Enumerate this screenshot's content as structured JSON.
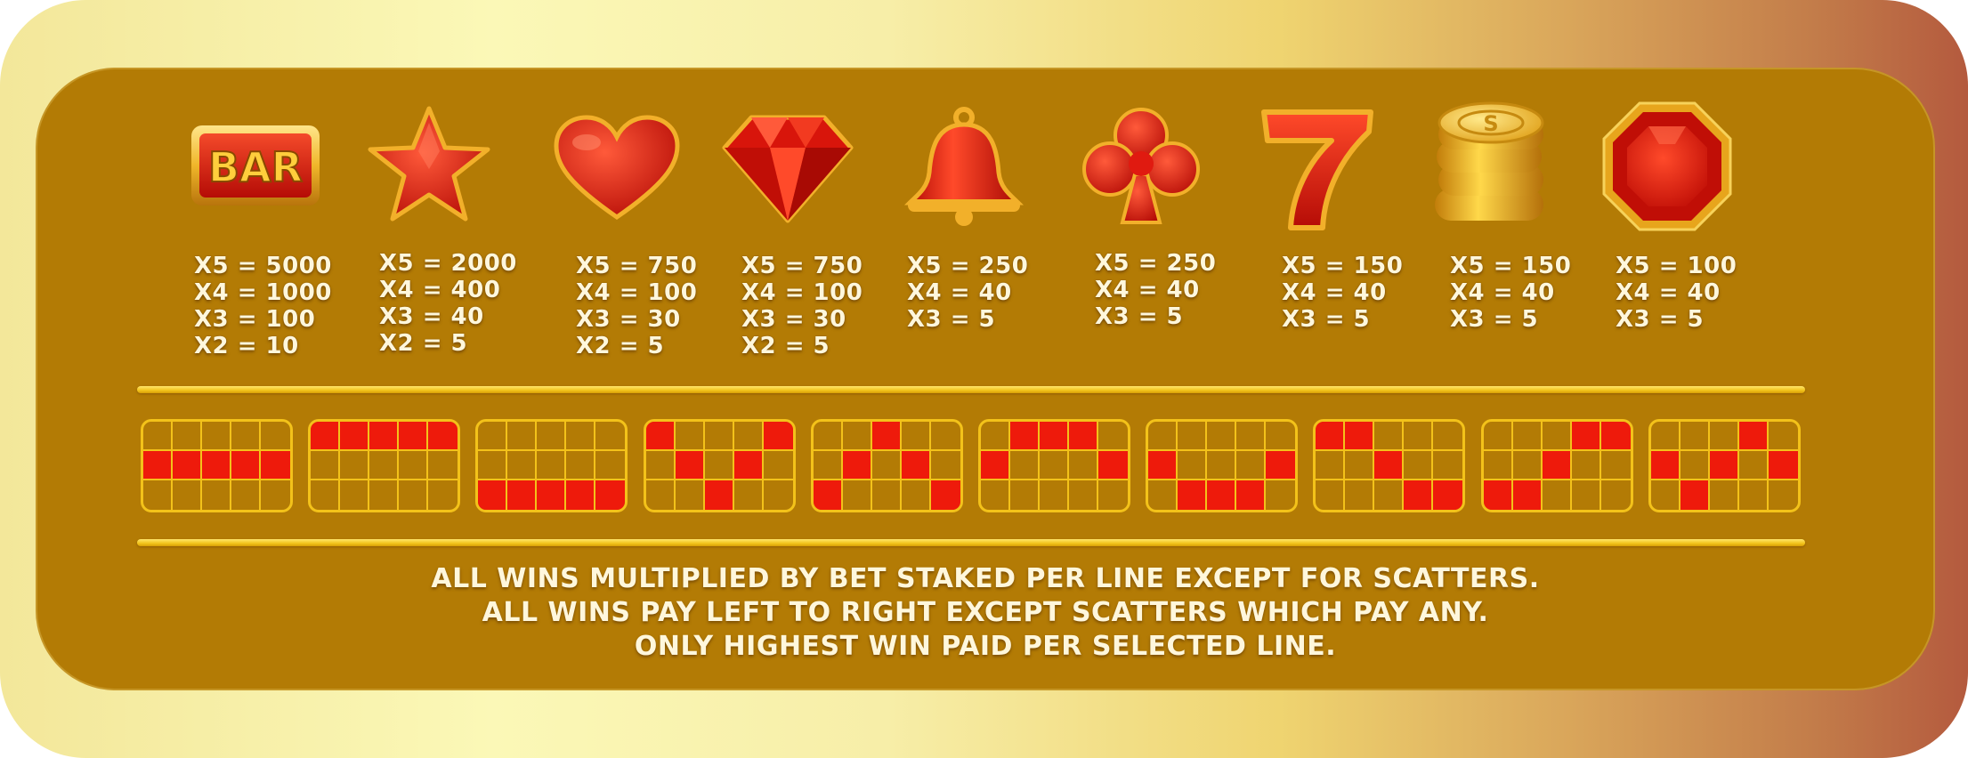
{
  "colors": {
    "panel": "#b37b05",
    "accent_gold": "#f3c21a",
    "symbol_red": "#e01a10",
    "text": "#fff7dc"
  },
  "symbols": [
    {
      "name": "bar",
      "icon": "bar-icon",
      "label": "BAR",
      "pays": [
        "X5 = 5000",
        "X4 = 1000",
        "X3 = 100",
        "X2 = 10"
      ]
    },
    {
      "name": "star",
      "icon": "star-icon",
      "pays": [
        "X5 = 2000",
        "X4 = 400",
        "X3 = 40",
        "X2 = 5"
      ]
    },
    {
      "name": "heart",
      "icon": "heart-icon",
      "pays": [
        "X5 = 750",
        "X4 = 100",
        "X3 = 30",
        "X2 = 5"
      ]
    },
    {
      "name": "diamond",
      "icon": "diamond-icon",
      "pays": [
        "X5 = 750",
        "X4 = 100",
        "X3 = 30",
        "X2 = 5"
      ]
    },
    {
      "name": "bell",
      "icon": "bell-icon",
      "pays": [
        "X5 = 250",
        "X4 = 40",
        "X3 = 5"
      ]
    },
    {
      "name": "clover",
      "icon": "clover-icon",
      "pays": [
        "X5 = 250",
        "X4 = 40",
        "X3 = 5"
      ]
    },
    {
      "name": "seven",
      "icon": "seven-icon",
      "label": "7",
      "pays": [
        "X5 = 150",
        "X4 = 40",
        "X3 = 5"
      ]
    },
    {
      "name": "coins",
      "icon": "coins-icon",
      "label": "S",
      "pays": [
        "X5 = 150",
        "X4 = 40",
        "X3 = 5"
      ]
    },
    {
      "name": "gem",
      "icon": "gem-icon",
      "pays": [
        "X5 = 100",
        "X4 = 40",
        "X3 = 5"
      ]
    }
  ],
  "paylines": [
    [
      1,
      1,
      1,
      1,
      1
    ],
    [
      0,
      0,
      0,
      0,
      0
    ],
    [
      2,
      2,
      2,
      2,
      2
    ],
    [
      0,
      1,
      2,
      1,
      0
    ],
    [
      2,
      1,
      0,
      1,
      2
    ],
    [
      1,
      0,
      0,
      0,
      1
    ],
    [
      1,
      2,
      2,
      2,
      1
    ],
    [
      0,
      0,
      1,
      2,
      2
    ],
    [
      2,
      2,
      1,
      0,
      0
    ],
    [
      1,
      2,
      1,
      0,
      1
    ]
  ],
  "rules": [
    "ALL WINS MULTIPLIED BY BET STAKED PER LINE EXCEPT FOR SCATTERS.",
    "ALL WINS PAY LEFT TO RIGHT EXCEPT SCATTERS WHICH PAY ANY.",
    "ONLY HIGHEST WIN PAID PER SELECTED LINE."
  ]
}
